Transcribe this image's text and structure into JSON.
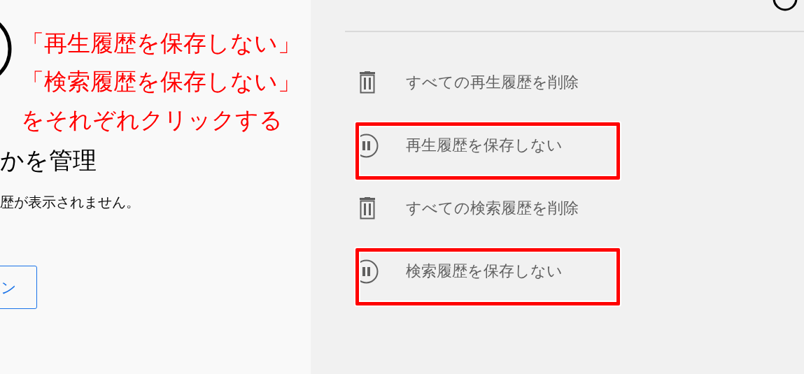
{
  "annotation": {
    "lines": [
      "「再生履歴を保存しない」",
      "「検索履歴を保存しない」",
      "をそれぞれクリックする"
    ]
  },
  "main": {
    "heading": "かを管理",
    "description": "歴が表示されません。",
    "button": "ン"
  },
  "sidebar": {
    "actions": [
      {
        "kind": "trash",
        "label": "すべての再生履歴を削除",
        "highlighted": false
      },
      {
        "kind": "pause",
        "label": "再生履歴を保存しない",
        "highlighted": true
      },
      {
        "kind": "trash",
        "label": "すべての検索履歴を削除",
        "highlighted": false
      },
      {
        "kind": "pause",
        "label": "検索履歴を保存しない",
        "highlighted": true
      }
    ]
  }
}
